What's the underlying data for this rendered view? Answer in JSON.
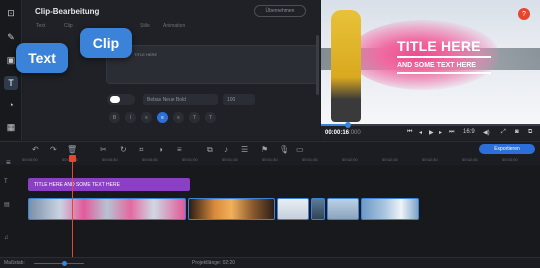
{
  "panel": {
    "title": "Clip-Bearbeitung",
    "top_button": "Übernehmen",
    "tabs": [
      "Text",
      "Clip",
      "Stile",
      "Animation"
    ],
    "text_placeholder": "TITLE HERE",
    "font": "Bebas Neue Bold",
    "size": "100"
  },
  "tooltips": {
    "text": "Text",
    "clip": "Clip"
  },
  "preview": {
    "title": "TITLE HERE",
    "subtitle": "AND SOME TEXT HERE"
  },
  "player": {
    "timecode": "00:00:16",
    "timecode_frac": ":000",
    "aspect": "16:9"
  },
  "toolbar": {
    "export": "Exportieren"
  },
  "ruler": [
    "00:00:00",
    "00:00:15",
    "00:00:30",
    "00:00:45",
    "00:01:00",
    "00:01:15",
    "00:01:30",
    "00:01:45",
    "00:02:00",
    "00:02:15",
    "00:02:30",
    "00:02:45",
    "00:03:00"
  ],
  "timeline": {
    "text_clip": "TITLE HERE AND SOME TEXT HERE"
  },
  "status": {
    "scale_label": "Maßstab:",
    "project_length": "Projektlänge: 02:20"
  }
}
